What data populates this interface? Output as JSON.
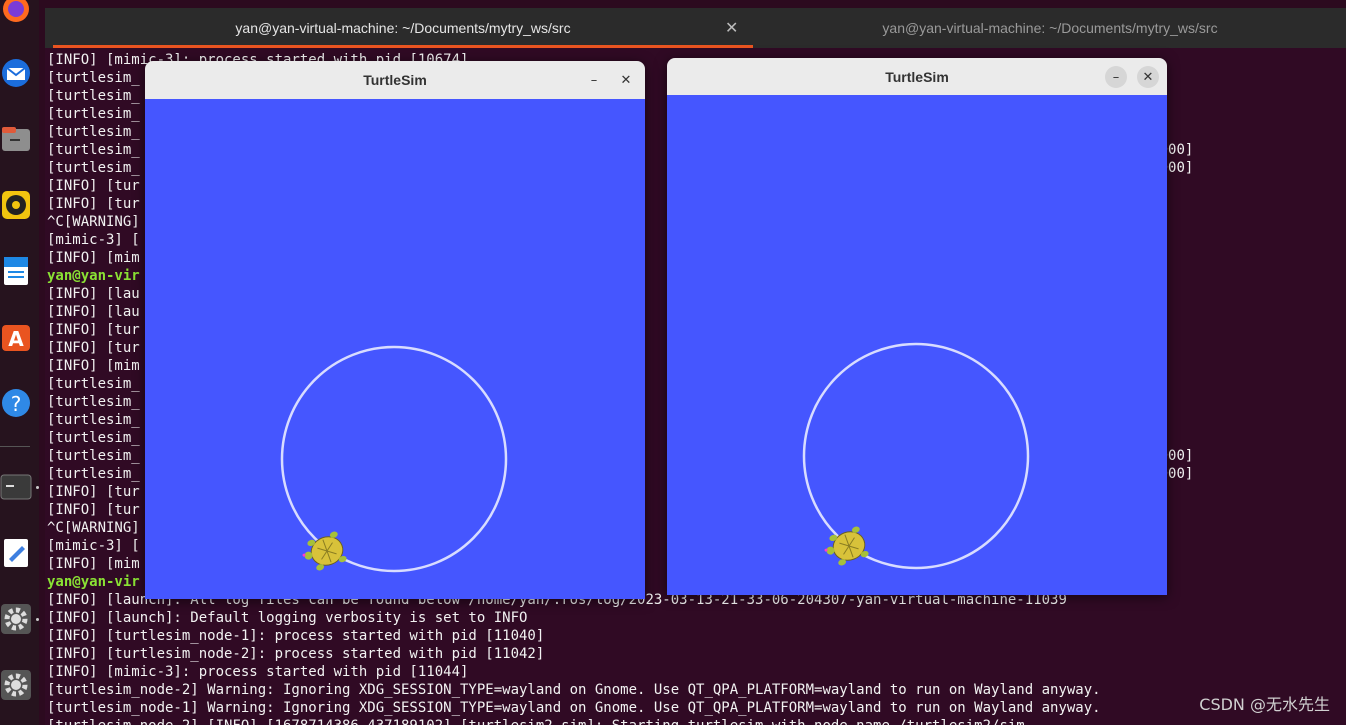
{
  "tabs": [
    {
      "title": "yan@yan-virtual-machine: ~/Documents/mytry_ws/src"
    },
    {
      "title": "yan@yan-virtual-machine: ~/Documents/mytry_ws/src"
    }
  ],
  "terminal_lines": [
    {
      "text": "[INFO] [mimic-3]: process started with pid [10674]"
    },
    {
      "text": "[turtlesim_                                                   nom"
    },
    {
      "text": "[turtlesim_                                                   nom"
    },
    {
      "text": "[turtlesim_                                                   St"
    },
    {
      "text": "[turtlesim_                                                   St"
    },
    {
      "text": "[turtlesim_                                                   Sp                                                        theta=[0.000000]"
    },
    {
      "text": "[turtlesim_                                                   Sp                                                        theta=[0.000000]"
    },
    {
      "text": "[INFO] [tur                                                   ]"
    },
    {
      "text": "[INFO] [tur                                                   ]"
    },
    {
      "text": "^C[WARNING]"
    },
    {
      "text": "[mimic-3] [                                                   .gn"
    },
    {
      "text": "[INFO] [mim"
    },
    {
      "text": "yan@yan-vir                                                   .es",
      "prompt": true
    },
    {
      "text": "[INFO] [lau                                                   og/"
    },
    {
      "text": "[INFO] [lau"
    },
    {
      "text": "[INFO] [tur"
    },
    {
      "text": "[INFO] [tur"
    },
    {
      "text": "[INFO] [mim"
    },
    {
      "text": "[turtlesim_                                                   nom"
    },
    {
      "text": "[turtlesim_                                                   nom"
    },
    {
      "text": "[turtlesim_                                                   St"
    },
    {
      "text": "[turtlesim_                                                   St"
    },
    {
      "text": "[turtlesim_                                                   Sp                                                        theta=[0.000000]"
    },
    {
      "text": "[turtlesim_                                                   Sp                                                        theta=[0.000000]"
    },
    {
      "text": "[INFO] [tur                                                   ]"
    },
    {
      "text": "[INFO] [tur                                                   ]"
    },
    {
      "text": "^C[WARNING]"
    },
    {
      "text": "[mimic-3] [                                                   .gn"
    },
    {
      "text": "[INFO] [mim"
    },
    {
      "text": "yan@yan-vir                                                   .es",
      "prompt": true
    },
    {
      "text": "[INFO] [launch]: All log files can be found below /home/yan/.ros/log/2023-03-13-21-33-06-204307-yan-virtual-machine-11039"
    },
    {
      "text": "[INFO] [launch]: Default logging verbosity is set to INFO"
    },
    {
      "text": "[INFO] [turtlesim_node-1]: process started with pid [11040]"
    },
    {
      "text": "[INFO] [turtlesim_node-2]: process started with pid [11042]"
    },
    {
      "text": "[INFO] [mimic-3]: process started with pid [11044]"
    },
    {
      "text": "[turtlesim_node-2] Warning: Ignoring XDG_SESSION_TYPE=wayland on Gnome. Use QT_QPA_PLATFORM=wayland to run on Wayland anyway."
    },
    {
      "text": "[turtlesim_node-1] Warning: Ignoring XDG_SESSION_TYPE=wayland on Gnome. Use QT_QPA_PLATFORM=wayland to run on Wayland anyway."
    },
    {
      "text": "[turtlesim_node-2] [INFO] [1678714386.437189102] [turtlesim2.sim]: Starting turtlesim with node name /turtlesim2/sim"
    }
  ],
  "windows": [
    {
      "title": "TurtleSim",
      "minimize": "–",
      "close": "✕"
    },
    {
      "title": "TurtleSim",
      "minimize": "–",
      "close": "✕"
    }
  ],
  "watermark": "CSDN @无水先生",
  "colors": {
    "canvas": "#4556ff",
    "terminal_bg": "#300a24",
    "accent": "#e95420",
    "trail": "#d8dcff"
  },
  "icons": [
    "firefox-icon",
    "thunderbird-icon",
    "files-icon",
    "rhythmbox-icon",
    "writer-icon",
    "software-center-icon",
    "help-icon",
    "terminal-icon",
    "text-editor-icon",
    "settings-icon",
    "settings-icon"
  ]
}
